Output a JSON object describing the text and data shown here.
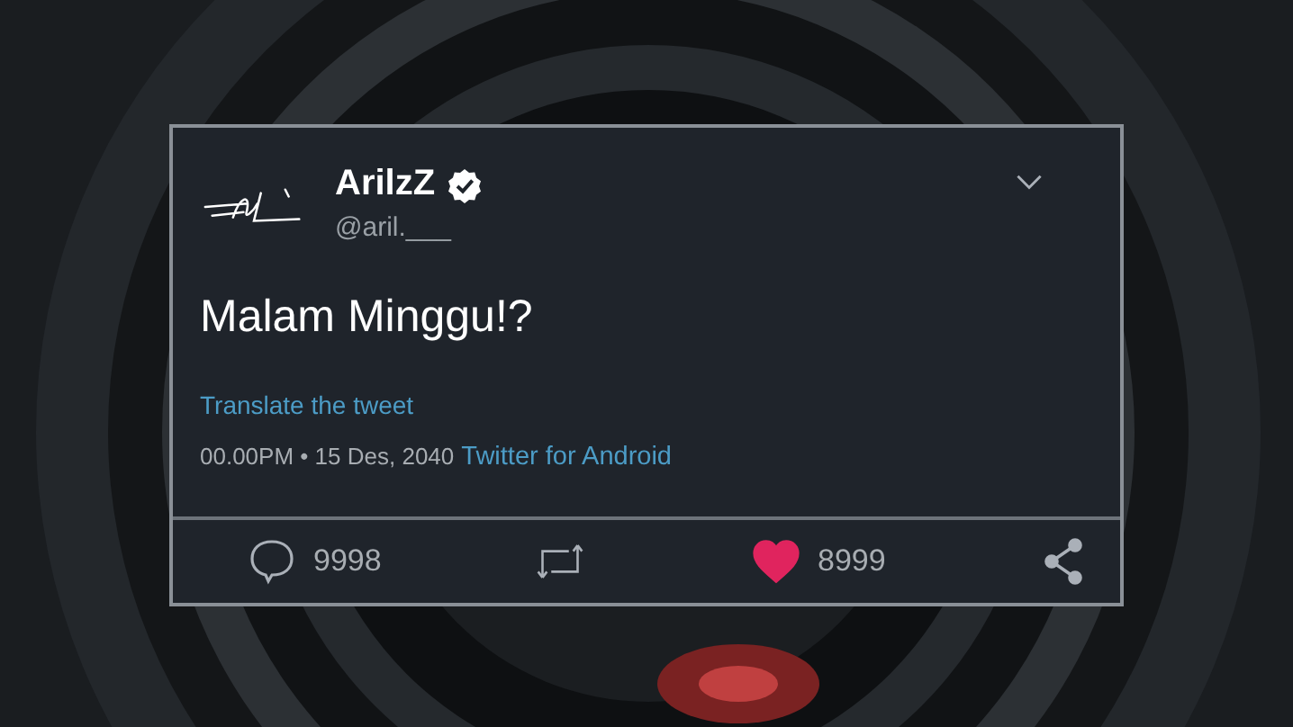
{
  "tweet": {
    "display_name": "ArilzZ",
    "verified": true,
    "handle": "@aril.___",
    "text": "Malam Minggu!?",
    "translate": "Translate the tweet",
    "timestamp": "00.00PM • 15 Des, 2040",
    "source": "Twitter for Android"
  },
  "actions": [
    {
      "kind": "reply",
      "count": "9998"
    },
    {
      "kind": "retweet"
    },
    {
      "kind": "like",
      "count": "8999",
      "liked": true
    },
    {
      "kind": "share"
    }
  ]
}
